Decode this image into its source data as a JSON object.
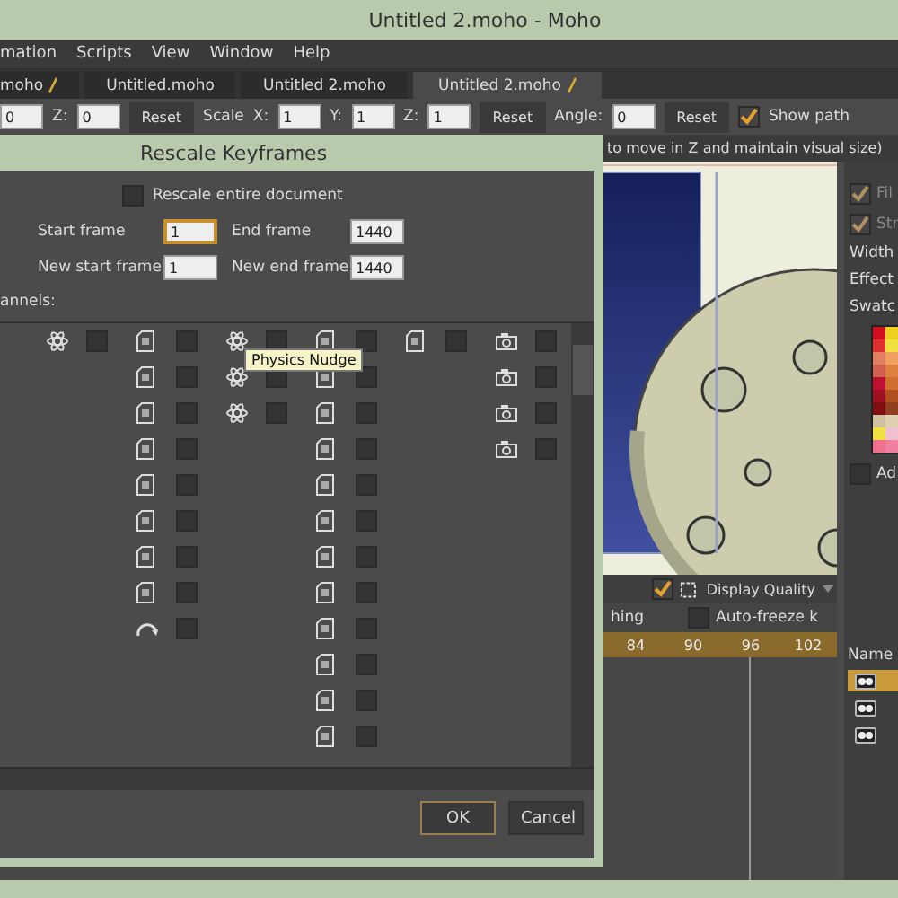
{
  "window": {
    "title": "Untitled 2.moho - Moho"
  },
  "menu": [
    "mation",
    "Scripts",
    "View",
    "Window",
    "Help"
  ],
  "tabs": [
    {
      "label": "moho",
      "modified": true,
      "selected": false
    },
    {
      "label": "Untitled.moho",
      "modified": false,
      "selected": false
    },
    {
      "label": "Untitled 2.moho",
      "modified": false,
      "selected": false
    },
    {
      "label": "Untitled 2.moho",
      "modified": true,
      "selected": true
    }
  ],
  "toolbar": [
    {
      "kind": "field",
      "value": "0"
    },
    {
      "kind": "label",
      "text": "Z:"
    },
    {
      "kind": "field",
      "value": "0"
    },
    {
      "kind": "button",
      "text": "Reset"
    },
    {
      "kind": "label",
      "text": "Scale"
    },
    {
      "kind": "label",
      "text": "X:"
    },
    {
      "kind": "field",
      "value": "1"
    },
    {
      "kind": "label",
      "text": "Y:"
    },
    {
      "kind": "field",
      "value": "1"
    },
    {
      "kind": "label",
      "text": "Z:"
    },
    {
      "kind": "field",
      "value": "1"
    },
    {
      "kind": "button",
      "text": "Reset"
    },
    {
      "kind": "label",
      "text": "Angle:"
    },
    {
      "kind": "field",
      "value": "0"
    },
    {
      "kind": "button",
      "text": "Reset"
    },
    {
      "kind": "checkbox",
      "text": "Show path",
      "checked": true
    }
  ],
  "hint": "to move in Z and maintain visual size)",
  "view_toolbar": {
    "checked": true,
    "quality": "Display Quality"
  },
  "timeline": {
    "label": "hing",
    "auto_freeze": {
      "label": "Auto-freeze k",
      "checked": false
    },
    "ruler": [
      "84",
      "90",
      "96",
      "102"
    ]
  },
  "style_panel": {
    "fill": {
      "label": "Fil",
      "checked": true
    },
    "stroke": {
      "label": "Str",
      "checked": true
    },
    "width": "Width",
    "effect": "Effect",
    "swatches": "Swatc",
    "add": {
      "label": "Ad",
      "checked": false
    }
  },
  "layers": {
    "header": "Name",
    "rows": [
      {
        "selected": true
      },
      {
        "selected": false
      },
      {
        "selected": false
      }
    ]
  },
  "dialog": {
    "title": "Rescale Keyframes",
    "rescale_entire": {
      "label": "Rescale entire document",
      "checked": false
    },
    "fields": [
      {
        "label": "Start frame",
        "value": "1",
        "focused": true
      },
      {
        "label": "End frame",
        "value": "1440",
        "focused": false
      },
      {
        "label": "New start frame",
        "value": "1",
        "focused": false
      },
      {
        "label": "New end frame",
        "value": "1440",
        "focused": false
      }
    ],
    "channels_label": "annels:",
    "channel_columns": [
      [
        {
          "kind": "atom",
          "checked": false
        }
      ],
      [
        {
          "kind": "doc",
          "checked": false
        },
        {
          "kind": "doc",
          "checked": false
        },
        {
          "kind": "doc",
          "checked": false
        },
        {
          "kind": "doc",
          "checked": false
        },
        {
          "kind": "doc",
          "checked": false
        },
        {
          "kind": "doc",
          "checked": false
        },
        {
          "kind": "doc",
          "checked": false
        },
        {
          "kind": "doc",
          "checked": false
        },
        {
          "kind": "arc",
          "checked": false
        }
      ],
      [
        {
          "kind": "atom",
          "checked": false
        },
        {
          "kind": "atom",
          "checked": false
        },
        {
          "kind": "atom",
          "checked": false
        }
      ],
      [
        {
          "kind": "doc",
          "checked": false
        },
        {
          "kind": "doc",
          "checked": false
        },
        {
          "kind": "doc",
          "checked": false
        },
        {
          "kind": "doc",
          "checked": false
        },
        {
          "kind": "doc",
          "checked": false
        },
        {
          "kind": "doc",
          "checked": false
        },
        {
          "kind": "doc",
          "checked": false
        },
        {
          "kind": "doc",
          "checked": false
        },
        {
          "kind": "doc",
          "checked": false
        },
        {
          "kind": "doc",
          "checked": false
        },
        {
          "kind": "doc",
          "checked": false
        },
        {
          "kind": "doc",
          "checked": false
        }
      ],
      [
        {
          "kind": "doc",
          "checked": false
        }
      ],
      [
        {
          "kind": "camera",
          "checked": false
        },
        {
          "kind": "camera",
          "checked": false
        },
        {
          "kind": "camera",
          "checked": false
        },
        {
          "kind": "camera",
          "checked": false
        }
      ]
    ],
    "tooltip": "Physics Nudge",
    "buttons": [
      {
        "label": "OK",
        "default": true
      },
      {
        "label": "Cancel",
        "default": false
      }
    ]
  }
}
